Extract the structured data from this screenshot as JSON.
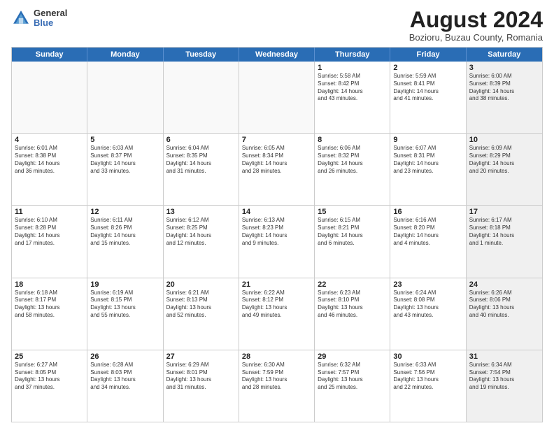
{
  "header": {
    "logo_general": "General",
    "logo_blue": "Blue",
    "month_year": "August 2024",
    "location": "Bozioru, Buzau County, Romania"
  },
  "days_of_week": [
    "Sunday",
    "Monday",
    "Tuesday",
    "Wednesday",
    "Thursday",
    "Friday",
    "Saturday"
  ],
  "weeks": [
    [
      {
        "day": "",
        "text": "",
        "empty": true
      },
      {
        "day": "",
        "text": "",
        "empty": true
      },
      {
        "day": "",
        "text": "",
        "empty": true
      },
      {
        "day": "",
        "text": "",
        "empty": true
      },
      {
        "day": "1",
        "text": "Sunrise: 5:58 AM\nSunset: 8:42 PM\nDaylight: 14 hours\nand 43 minutes.",
        "empty": false
      },
      {
        "day": "2",
        "text": "Sunrise: 5:59 AM\nSunset: 8:41 PM\nDaylight: 14 hours\nand 41 minutes.",
        "empty": false
      },
      {
        "day": "3",
        "text": "Sunrise: 6:00 AM\nSunset: 8:39 PM\nDaylight: 14 hours\nand 38 minutes.",
        "empty": false,
        "shaded": true
      }
    ],
    [
      {
        "day": "4",
        "text": "Sunrise: 6:01 AM\nSunset: 8:38 PM\nDaylight: 14 hours\nand 36 minutes.",
        "empty": false
      },
      {
        "day": "5",
        "text": "Sunrise: 6:03 AM\nSunset: 8:37 PM\nDaylight: 14 hours\nand 33 minutes.",
        "empty": false
      },
      {
        "day": "6",
        "text": "Sunrise: 6:04 AM\nSunset: 8:35 PM\nDaylight: 14 hours\nand 31 minutes.",
        "empty": false
      },
      {
        "day": "7",
        "text": "Sunrise: 6:05 AM\nSunset: 8:34 PM\nDaylight: 14 hours\nand 28 minutes.",
        "empty": false
      },
      {
        "day": "8",
        "text": "Sunrise: 6:06 AM\nSunset: 8:32 PM\nDaylight: 14 hours\nand 26 minutes.",
        "empty": false
      },
      {
        "day": "9",
        "text": "Sunrise: 6:07 AM\nSunset: 8:31 PM\nDaylight: 14 hours\nand 23 minutes.",
        "empty": false
      },
      {
        "day": "10",
        "text": "Sunrise: 6:09 AM\nSunset: 8:29 PM\nDaylight: 14 hours\nand 20 minutes.",
        "empty": false,
        "shaded": true
      }
    ],
    [
      {
        "day": "11",
        "text": "Sunrise: 6:10 AM\nSunset: 8:28 PM\nDaylight: 14 hours\nand 17 minutes.",
        "empty": false
      },
      {
        "day": "12",
        "text": "Sunrise: 6:11 AM\nSunset: 8:26 PM\nDaylight: 14 hours\nand 15 minutes.",
        "empty": false
      },
      {
        "day": "13",
        "text": "Sunrise: 6:12 AM\nSunset: 8:25 PM\nDaylight: 14 hours\nand 12 minutes.",
        "empty": false
      },
      {
        "day": "14",
        "text": "Sunrise: 6:13 AM\nSunset: 8:23 PM\nDaylight: 14 hours\nand 9 minutes.",
        "empty": false
      },
      {
        "day": "15",
        "text": "Sunrise: 6:15 AM\nSunset: 8:21 PM\nDaylight: 14 hours\nand 6 minutes.",
        "empty": false
      },
      {
        "day": "16",
        "text": "Sunrise: 6:16 AM\nSunset: 8:20 PM\nDaylight: 14 hours\nand 4 minutes.",
        "empty": false
      },
      {
        "day": "17",
        "text": "Sunrise: 6:17 AM\nSunset: 8:18 PM\nDaylight: 14 hours\nand 1 minute.",
        "empty": false,
        "shaded": true
      }
    ],
    [
      {
        "day": "18",
        "text": "Sunrise: 6:18 AM\nSunset: 8:17 PM\nDaylight: 13 hours\nand 58 minutes.",
        "empty": false
      },
      {
        "day": "19",
        "text": "Sunrise: 6:19 AM\nSunset: 8:15 PM\nDaylight: 13 hours\nand 55 minutes.",
        "empty": false
      },
      {
        "day": "20",
        "text": "Sunrise: 6:21 AM\nSunset: 8:13 PM\nDaylight: 13 hours\nand 52 minutes.",
        "empty": false
      },
      {
        "day": "21",
        "text": "Sunrise: 6:22 AM\nSunset: 8:12 PM\nDaylight: 13 hours\nand 49 minutes.",
        "empty": false
      },
      {
        "day": "22",
        "text": "Sunrise: 6:23 AM\nSunset: 8:10 PM\nDaylight: 13 hours\nand 46 minutes.",
        "empty": false
      },
      {
        "day": "23",
        "text": "Sunrise: 6:24 AM\nSunset: 8:08 PM\nDaylight: 13 hours\nand 43 minutes.",
        "empty": false
      },
      {
        "day": "24",
        "text": "Sunrise: 6:26 AM\nSunset: 8:06 PM\nDaylight: 13 hours\nand 40 minutes.",
        "empty": false,
        "shaded": true
      }
    ],
    [
      {
        "day": "25",
        "text": "Sunrise: 6:27 AM\nSunset: 8:05 PM\nDaylight: 13 hours\nand 37 minutes.",
        "empty": false
      },
      {
        "day": "26",
        "text": "Sunrise: 6:28 AM\nSunset: 8:03 PM\nDaylight: 13 hours\nand 34 minutes.",
        "empty": false
      },
      {
        "day": "27",
        "text": "Sunrise: 6:29 AM\nSunset: 8:01 PM\nDaylight: 13 hours\nand 31 minutes.",
        "empty": false
      },
      {
        "day": "28",
        "text": "Sunrise: 6:30 AM\nSunset: 7:59 PM\nDaylight: 13 hours\nand 28 minutes.",
        "empty": false
      },
      {
        "day": "29",
        "text": "Sunrise: 6:32 AM\nSunset: 7:57 PM\nDaylight: 13 hours\nand 25 minutes.",
        "empty": false
      },
      {
        "day": "30",
        "text": "Sunrise: 6:33 AM\nSunset: 7:56 PM\nDaylight: 13 hours\nand 22 minutes.",
        "empty": false
      },
      {
        "day": "31",
        "text": "Sunrise: 6:34 AM\nSunset: 7:54 PM\nDaylight: 13 hours\nand 19 minutes.",
        "empty": false,
        "shaded": true
      }
    ]
  ]
}
